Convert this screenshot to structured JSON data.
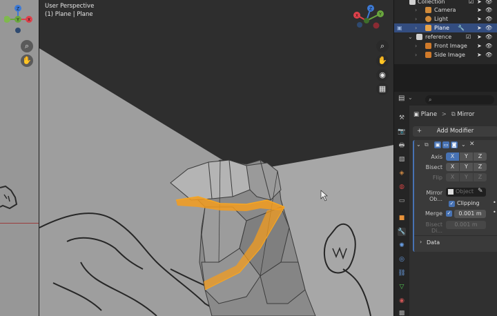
{
  "viewport": {
    "view_name": "User Perspective",
    "object_info": "(1) Plane | Plane",
    "gizmo_axes": {
      "x": "X",
      "y": "Y",
      "z": "Z"
    }
  },
  "outliner": {
    "rows": [
      {
        "label": "Collection",
        "icon": "collection-icon"
      },
      {
        "label": "Camera",
        "icon": "camera-icon"
      },
      {
        "label": "Light",
        "icon": "light-icon"
      },
      {
        "label": "Plane",
        "icon": "mesh-icon",
        "selected": true
      },
      {
        "label": "reference",
        "icon": "collection-icon"
      },
      {
        "label": "Front Image",
        "icon": "image-icon"
      },
      {
        "label": "Side Image",
        "icon": "image-icon"
      }
    ]
  },
  "properties": {
    "breadcrumb_object": "Plane",
    "breadcrumb_separator": ">",
    "breadcrumb_modifier": "Mirror",
    "add_modifier_label": "Add Modifier",
    "axis_label": "Axis",
    "bisect_label": "Bisect",
    "flip_label": "Flip",
    "axis_buttons": [
      "X",
      "Y",
      "Z"
    ],
    "mirror_object_label": "Mirror Ob...",
    "mirror_object_placeholder": "Object",
    "clipping_label": "Clipping",
    "merge_label": "Merge",
    "merge_value": "0.001 m",
    "bisect_distance_label": "Bisect Di...",
    "bisect_distance_value": "0.001 m",
    "data_label": "Data"
  },
  "colors": {
    "selection_orange": "#f39c1f",
    "accent_blue": "#4772b3",
    "axis_x": "#e0414b",
    "axis_y": "#6aa73e",
    "axis_z": "#3d7ad6"
  }
}
